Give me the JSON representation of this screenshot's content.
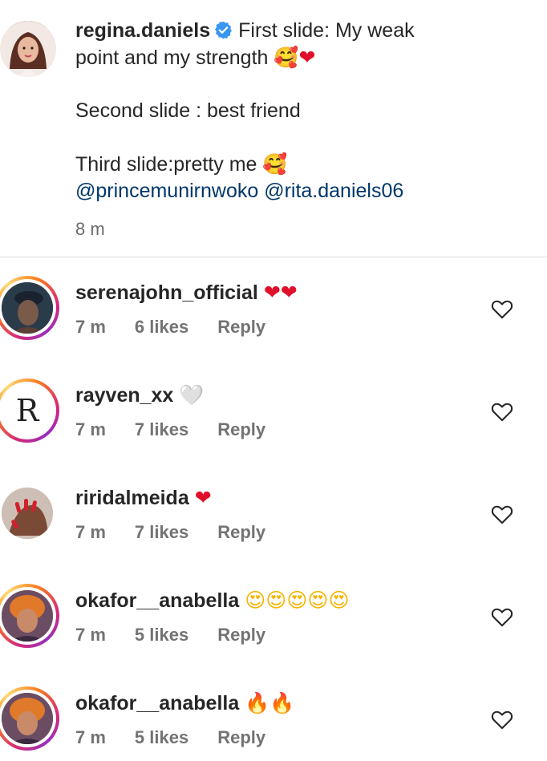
{
  "caption": {
    "username": "regina.daniels",
    "lines": [
      "First slide: My weak",
      "point and my strength",
      "Second slide : best friend",
      "Third slide:pretty me"
    ],
    "emoji_line2": "🥰❤",
    "emoji_line4": "🥰",
    "mentions": "@princemunirnwoko @rita.daniels06",
    "time": "8 m"
  },
  "comments": [
    {
      "username": "serenajohn_official",
      "emojis": "❤❤",
      "time": "7 m",
      "likes": "6 likes",
      "reply": "Reply"
    },
    {
      "username": "rayven_xx",
      "emojis": "🤍",
      "time": "7 m",
      "likes": "7 likes",
      "reply": "Reply",
      "avatar_letter": "R"
    },
    {
      "username": "riridalmeida",
      "emojis": "❤",
      "time": "7 m",
      "likes": "7 likes",
      "reply": "Reply"
    },
    {
      "username": "okafor__anabella",
      "emojis": "😍😍😍😍😍",
      "time": "7 m",
      "likes": "5 likes",
      "reply": "Reply"
    },
    {
      "username": "okafor__anabella",
      "emojis": "🔥🔥",
      "time": "7 m",
      "likes": "5 likes",
      "reply": "Reply"
    }
  ],
  "icons": {
    "verified": "verified-badge-icon",
    "like": "heart-outline-icon"
  },
  "colors": {
    "mention": "#00376b",
    "verified": "#3897f0",
    "meta_text": "#737373"
  }
}
